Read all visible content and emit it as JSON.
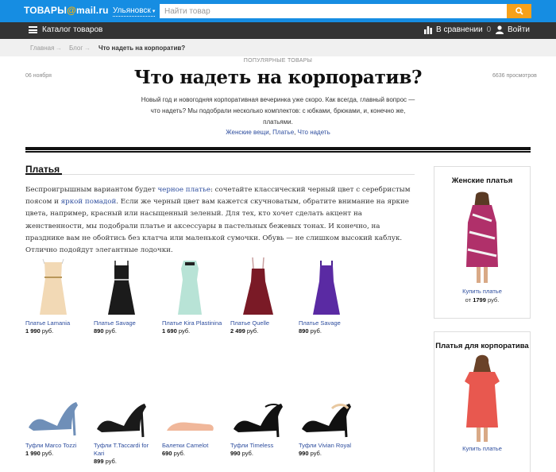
{
  "header": {
    "logo_left": "ТОВАРЫ",
    "logo_at": "@",
    "logo_right": "mail.ru",
    "city": "Ульяновск",
    "search_placeholder": "Найти товар"
  },
  "nav": {
    "catalog": "Каталог товаров",
    "compare_label": "В сравнении",
    "compare_count": "0",
    "login": "Войти"
  },
  "breadcrumbs": [
    "Главная",
    "Блог",
    "Что надеть на корпоратив?"
  ],
  "article": {
    "kicker": "ПОПУЛЯРНЫЕ ТОВАРЫ",
    "date": "06 ноября",
    "views": "6636 просмотров",
    "title": "Что надеть на корпоратив?",
    "lead": "Новый год и новогодняя корпоративная вечеринка уже скоро. Как всегда, главный вопрос — что надеть? Мы подобрали несколько комплектов: с юбками, брюками, и, конечно же, платьями.",
    "tags": [
      "Женские вещи",
      "Платье",
      "Что надеть"
    ],
    "tag_sep": ", "
  },
  "section": {
    "title": "Платья",
    "p1": "Беспроигрышным вариантом будет ",
    "link1": "черное платье",
    "p2": ": сочетайте классический черный цвет с серебристым поясом и ",
    "link2": "яркой помадой",
    "p3": ". Если же черный цвет вам кажется скучноватым, обратите внимание на яркие цвета, например, красный или насыщенный зеленый. Для тех, кто хочет сделать акцент на женственности, мы подобрали платье и аксессуары в пастельных бежевых тонах. И конечно, на празднике вам не обойтись без клатча или маленькой сумочки. Обувь — не слишком высокий каблук. Отлично подойдут элегантные лодочки."
  },
  "dresses": [
    {
      "name": "Платье Lamania",
      "price": "1 990",
      "currency": "руб.",
      "color": "#f2d9b5"
    },
    {
      "name": "Платье Savage",
      "price": "890",
      "currency": "руб.",
      "color": "#1b1b1b"
    },
    {
      "name": "Платье Kira Plastinina",
      "price": "1 690",
      "currency": "руб.",
      "color": "#b8e3d6"
    },
    {
      "name": "Платье Quelle",
      "price": "2 499",
      "currency": "руб.",
      "color": "#7a1a26"
    },
    {
      "name": "Платье Savage",
      "price": "890",
      "currency": "руб.",
      "color": "#5a2aa3"
    }
  ],
  "shoes": [
    {
      "name": "Туфли Marco Tozzi",
      "price": "1 990",
      "currency": "руб.",
      "color": "#6f8fb8"
    },
    {
      "name": "Туфли T.Taccardi for Kari",
      "price": "899",
      "currency": "руб.",
      "color": "#1a1a1a"
    },
    {
      "name": "Балетки Camelot",
      "price": "690",
      "currency": "руб.",
      "color": "#f0b79a"
    },
    {
      "name": "Туфли Timeless",
      "price": "990",
      "currency": "руб.",
      "color": "#111111"
    },
    {
      "name": "Туфли Vivian Royal",
      "price": "990",
      "currency": "руб.",
      "color": "#111111"
    }
  ],
  "sidebar": [
    {
      "title": "Женские платья",
      "buy": "Купить платье",
      "from_prefix": "от",
      "price": "1799",
      "currency": "руб."
    },
    {
      "title": "Платья для корпоратива",
      "buy": "Купить платье"
    }
  ],
  "colors": {
    "topbar": "#168de2",
    "navbar": "#333333",
    "search_button": "#f7a11a",
    "link": "#2d4d9e"
  }
}
